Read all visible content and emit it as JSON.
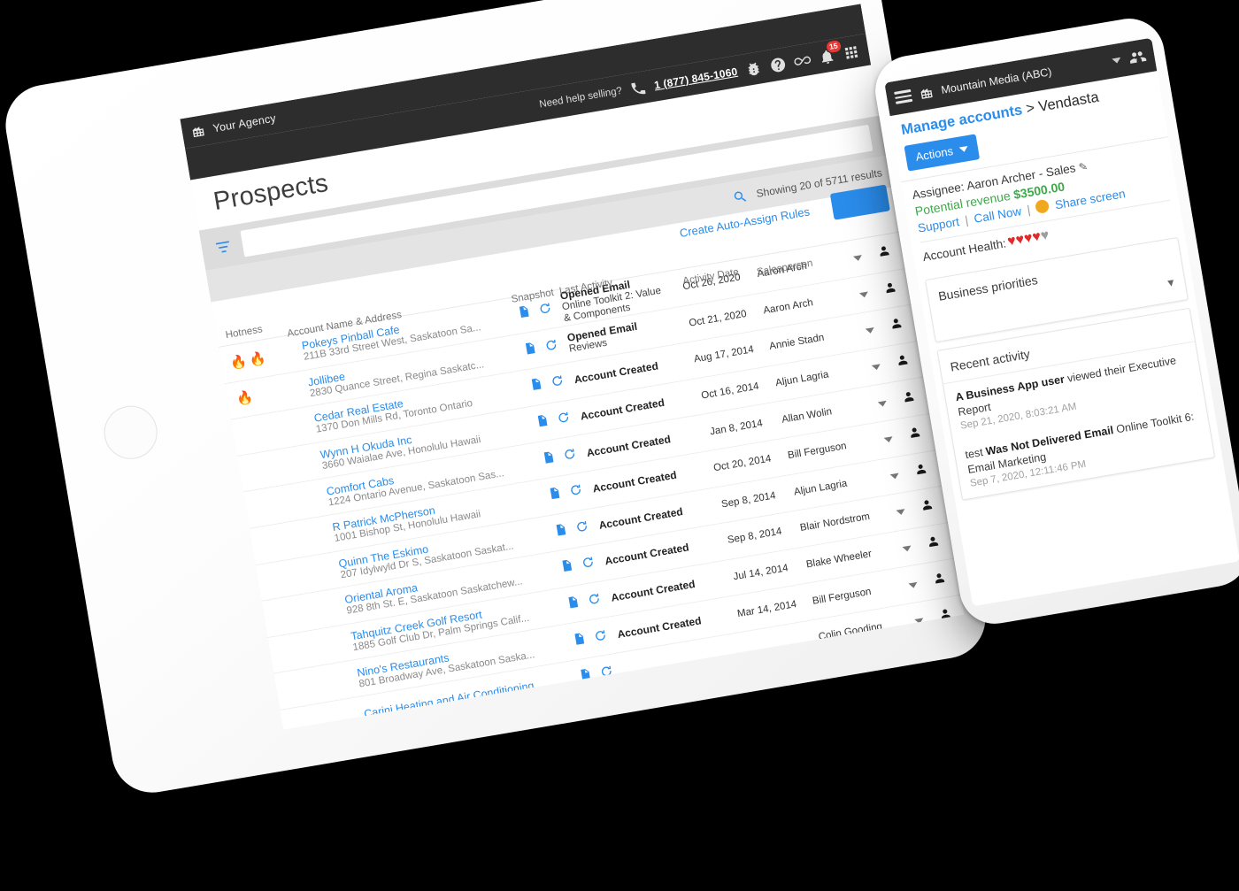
{
  "tablet": {
    "topbar": {
      "building_icon": "building-icon",
      "agency_name": "Your Agency"
    },
    "helpbar": {
      "need_help": "Need help selling?",
      "phone_icon": "phone-icon",
      "phone_number": "1 (877) 845-1060",
      "icons": [
        "bug-icon",
        "help-icon",
        "infinity-icon",
        "bell-icon",
        "grid-apps-icon"
      ],
      "bell_badge": "15"
    },
    "page_title": "Prospects",
    "filter_icon": "filter-icon",
    "search": {
      "icon": "search-icon",
      "value": "",
      "placeholder": ""
    },
    "showing_text": "Showing 20 of 5711 results",
    "auto_assign_link": "Create Auto-Assign Rules",
    "columns": {
      "hotness": "Hotness",
      "name": "Account Name & Address",
      "snapshot": "Snapshot",
      "last_activity": "Last Activity",
      "activity_date": "Activity Date",
      "salesperson": "Salesperson"
    },
    "rows": [
      {
        "flames": 2,
        "name": "Pokeys Pinball Cafe",
        "address": "211B 33rd Street West, Saskatoon Sa...",
        "activity_title": "Opened Email",
        "activity_sub": "Online Toolkit 2: Value & Components",
        "date": "Oct 26, 2020",
        "salesperson": "Aaron Arch"
      },
      {
        "flames": 1,
        "name": "Jollibee",
        "address": "2830 Quance Street, Regina Saskatc...",
        "activity_title": "Opened Email",
        "activity_sub": "Reviews",
        "date": "Oct 21, 2020",
        "salesperson": "Aaron Arch"
      },
      {
        "flames": 0,
        "name": "Cedar Real Estate",
        "address": "1370 Don Mills Rd, Toronto Ontario",
        "activity_title": "Account Created",
        "activity_sub": "",
        "date": "Aug 17, 2014",
        "salesperson": "Annie Stadn"
      },
      {
        "flames": 0,
        "name": "Wynn H Okuda Inc",
        "address": "3660 Waialae Ave, Honolulu Hawaii",
        "activity_title": "Account Created",
        "activity_sub": "",
        "date": "Oct 16, 2014",
        "salesperson": "Aljun Lagria"
      },
      {
        "flames": 0,
        "name": "Comfort Cabs",
        "address": "1224 Ontario Avenue, Saskatoon Sas...",
        "activity_title": "Account Created",
        "activity_sub": "",
        "date": "Jan 8, 2014",
        "salesperson": "Allan Wolin"
      },
      {
        "flames": 0,
        "name": "R Patrick McPherson",
        "address": "1001 Bishop St, Honolulu Hawaii",
        "activity_title": "Account Created",
        "activity_sub": "",
        "date": "Oct 20, 2014",
        "salesperson": "Bill Ferguson"
      },
      {
        "flames": 0,
        "name": "Quinn The Eskimo",
        "address": "207 Idylwyld Dr S, Saskatoon Saskat...",
        "activity_title": "Account Created",
        "activity_sub": "",
        "date": "Sep 8, 2014",
        "salesperson": "Aljun Lagria"
      },
      {
        "flames": 0,
        "name": "Oriental Aroma",
        "address": "928 8th St. E, Saskatoon Saskatchew...",
        "activity_title": "Account Created",
        "activity_sub": "",
        "date": "Sep 8, 2014",
        "salesperson": "Blair Nordstrom"
      },
      {
        "flames": 0,
        "name": "Tahquitz Creek Golf Resort",
        "address": "1885 Golf Club Dr, Palm Springs Calif...",
        "activity_title": "Account Created",
        "activity_sub": "",
        "date": "Jul 14, 2014",
        "salesperson": "Blake Wheeler"
      },
      {
        "flames": 0,
        "name": "Nino's Restaurants",
        "address": "801 Broadway Ave, Saskatoon Saska...",
        "activity_title": "Account Created",
        "activity_sub": "",
        "date": "Mar 14, 2014",
        "salesperson": "Bill Ferguson"
      },
      {
        "flames": 0,
        "name": "Carini Heating and Air Conditioning,",
        "address": "",
        "activity_title": "",
        "activity_sub": "",
        "date": "",
        "salesperson": "Colin Gooding"
      }
    ]
  },
  "phone": {
    "topbar": {
      "menu_icon": "hamburger-menu-icon",
      "building_icon": "building-icon",
      "account_name": "Mountain Media (ABC)",
      "dropdown_icon": "chevron-down-icon",
      "people_icon": "people-icon"
    },
    "breadcrumb": {
      "link": "Manage accounts",
      "separator": ">",
      "current": "Vendasta"
    },
    "actions_button": "Actions",
    "assignee_label": "Assignee:",
    "assignee_name": "Aaron Archer - Sales",
    "edit_icon": "pencil-icon",
    "revenue_label": "Potential revenue",
    "revenue_amount": "$3500.00",
    "support_link": "Support",
    "call_now_link": "Call Now",
    "share_screen_link": "Share screen",
    "share_icon": "share-screen-icon",
    "health_label": "Account Health:",
    "health_filled": 4,
    "health_total": 5,
    "business_priorities": "Business priorities",
    "recent_activity_title": "Recent activity",
    "activities": [
      {
        "bold_lead": "A Business App user",
        "text": " viewed their Executive Report",
        "time": "Sep 21, 2020, 8:03:21 AM"
      },
      {
        "pre": "test ",
        "bold_lead": "Was Not Delivered Email",
        "text": " Online Toolkit 6: Email Marketing",
        "time": "Sep 7, 2020, 12:11:46 PM"
      }
    ]
  },
  "colors": {
    "accent_blue": "#2a8ceb",
    "dark_header": "#2d2d2d",
    "flame_red": "#e8192c",
    "revenue_green": "#3ea84b",
    "heart_red": "#e02b2b",
    "badge_red": "#e53935"
  }
}
